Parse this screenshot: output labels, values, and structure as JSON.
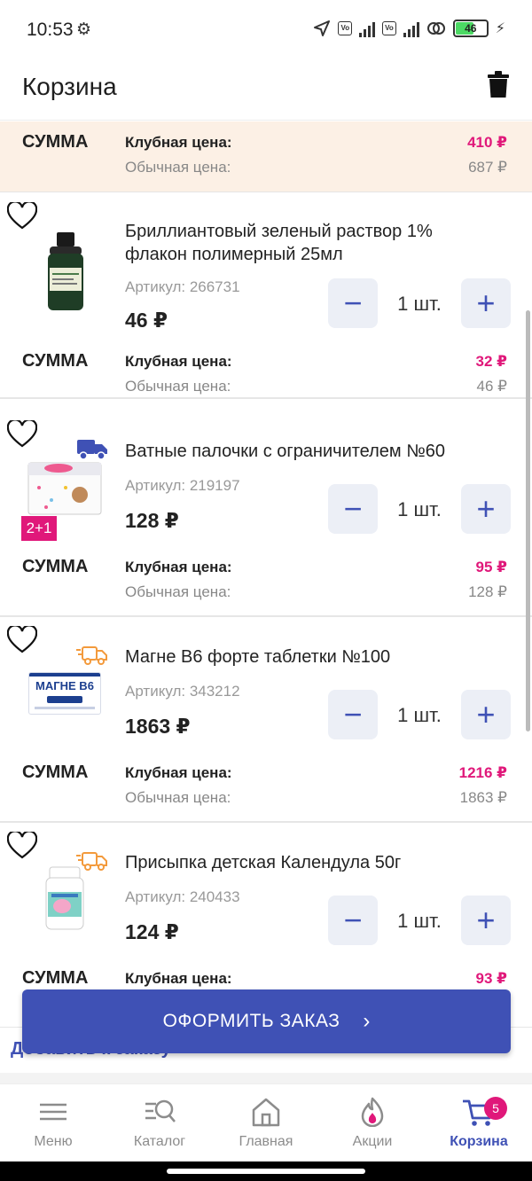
{
  "status_bar": {
    "time": "10:53",
    "battery": "46"
  },
  "header": {
    "title": "Корзина"
  },
  "total": {
    "sum_label": "СУММА",
    "club_label": "Клубная цена:",
    "club_value": "410 ₽",
    "regular_label": "Обычная цена:",
    "regular_value": "687 ₽"
  },
  "items": [
    {
      "title": "Бриллиантовый зеленый раствор 1% флакон полимерный 25мл",
      "article": "Артикул: 266731",
      "price": "46 ₽",
      "qty": "1 шт.",
      "sum_label": "СУММА",
      "club_label": "Клубная цена:",
      "club_value": "32 ₽",
      "regular_label": "Обычная цена:",
      "regular_value": "46 ₽"
    },
    {
      "title": "Ватные палочки с ограничителем №60",
      "article": "Артикул: 219197",
      "price": "128 ₽",
      "qty": "1 шт.",
      "promo": "2+1",
      "sum_label": "СУММА",
      "club_label": "Клубная цена:",
      "club_value": "95 ₽",
      "regular_label": "Обычная цена:",
      "regular_value": "128 ₽"
    },
    {
      "title": "Магне B6 форте таблетки №100",
      "article": "Артикул: 343212",
      "price": "1863 ₽",
      "qty": "1 шт.",
      "package_text": "МАГНЕ В6",
      "sum_label": "СУММА",
      "club_label": "Клубная цена:",
      "club_value": "1216 ₽",
      "regular_label": "Обычная цена:",
      "regular_value": "1863 ₽"
    },
    {
      "title": "Присыпка детская Календула 50г",
      "article": "Артикул: 240433",
      "price": "124 ₽",
      "qty": "1 шт.",
      "sum_label": "СУММА",
      "club_label": "Клубная цена:",
      "club_value": "93 ₽"
    }
  ],
  "qty_controls": {
    "minus": "−",
    "plus": "+"
  },
  "add_to_order": "Добавить к заказу",
  "checkout": {
    "label": "ОФОРМИТЬ ЗАКАЗ",
    "chevron": "›"
  },
  "nav": {
    "items": [
      {
        "label": "Меню",
        "icon": "menu-icon"
      },
      {
        "label": "Каталог",
        "icon": "catalog-search-icon"
      },
      {
        "label": "Главная",
        "icon": "home-icon"
      },
      {
        "label": "Акции",
        "icon": "flame-icon"
      },
      {
        "label": "Корзина",
        "icon": "cart-icon"
      }
    ],
    "cart_badge": "5"
  },
  "colors": {
    "accent": "#3f51b5",
    "club_price": "#e0187a",
    "banner_bg": "#fcf0e5",
    "delivery_icon_blue": "#3f51b5",
    "delivery_icon_orange": "#f39a3c"
  }
}
